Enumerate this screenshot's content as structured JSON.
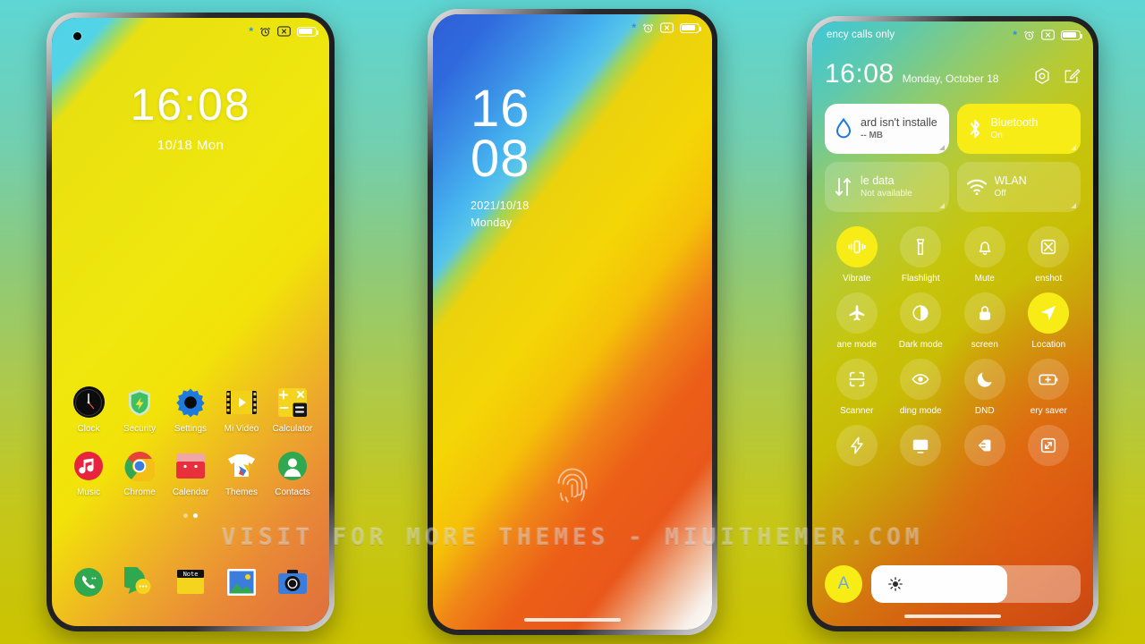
{
  "watermark": "VISIT FOR MORE THEMES - MIUITHEMER.COM",
  "colors": {
    "background_top": "#5ed6d4",
    "background_bottom": "#ccc300",
    "accent_yellow": "#f7ec16",
    "bluetooth_blue": "#1e90ff"
  },
  "phone1": {
    "statusbar": {
      "icons": [
        "bluetooth-icon",
        "alarm-icon",
        "silent-icon",
        "battery-icon"
      ]
    },
    "lockscreen": {
      "time": "16:08",
      "date": "10/18 Mon"
    },
    "apps_row1": [
      {
        "label": "Clock",
        "icon": "clock-icon"
      },
      {
        "label": "Security",
        "icon": "shield-icon"
      },
      {
        "label": "Settings",
        "icon": "gear-icon"
      },
      {
        "label": "Mi Video",
        "icon": "video-icon"
      },
      {
        "label": "Calculator",
        "icon": "calculator-icon"
      }
    ],
    "apps_row2": [
      {
        "label": "Music",
        "icon": "music-note-icon"
      },
      {
        "label": "Chrome",
        "icon": "chrome-icon"
      },
      {
        "label": "Calendar",
        "icon": "calendar-icon"
      },
      {
        "label": "Themes",
        "icon": "tshirt-icon"
      },
      {
        "label": "Contacts",
        "icon": "person-icon"
      }
    ],
    "dock": [
      {
        "label": "Phone",
        "icon": "phone-icon"
      },
      {
        "label": "Messages",
        "icon": "message-bubble-icon"
      },
      {
        "label": "Notes",
        "icon": "notes-icon",
        "badge": "Note"
      },
      {
        "label": "Gallery",
        "icon": "gallery-icon"
      },
      {
        "label": "Camera",
        "icon": "camera-icon"
      }
    ],
    "page_dots": {
      "count": 2,
      "active_index": 1
    }
  },
  "phone2": {
    "statusbar": {
      "icons": [
        "bluetooth-icon",
        "alarm-icon",
        "silent-icon",
        "battery-icon"
      ]
    },
    "lockscreen": {
      "hour": "16",
      "minute": "08",
      "date": "2021/10/18",
      "weekday": "Monday"
    },
    "fingerprint_label": "fingerprint-icon"
  },
  "phone3": {
    "statusbar": {
      "carrier": "ency calls only",
      "icons": [
        "bluetooth-icon",
        "alarm-icon",
        "silent-icon",
        "battery-icon"
      ]
    },
    "header": {
      "time": "16:08",
      "date": "Monday, October 18",
      "actions": [
        "settings-hex-icon",
        "edit-icon"
      ]
    },
    "big_tiles": [
      {
        "name": "ard isn't installe",
        "sub": "-- MB",
        "state": "white",
        "icon": "water-drop-icon"
      },
      {
        "name": "Bluetooth",
        "sub": "On",
        "state": "on",
        "icon": "bluetooth-icon"
      },
      {
        "name": "le data",
        "sub": "Not available",
        "state": "off",
        "icon": "data-arrows-icon"
      },
      {
        "name": "WLAN",
        "sub": "Off",
        "state": "off",
        "icon": "wifi-icon"
      }
    ],
    "toggles": [
      {
        "label": "Vibrate",
        "icon": "vibrate-icon",
        "active": true
      },
      {
        "label": "Flashlight",
        "icon": "flashlight-icon",
        "active": false
      },
      {
        "label": "Mute",
        "icon": "bell-icon",
        "active": false
      },
      {
        "label": "enshot",
        "icon": "screenshot-icon",
        "active": false
      },
      {
        "label": "ane mode",
        "icon": "airplane-icon",
        "active": false
      },
      {
        "label": "Dark mode",
        "icon": "dark-mode-icon",
        "active": false
      },
      {
        "label": "screen",
        "icon": "lock-icon",
        "active": false
      },
      {
        "label": "Location",
        "icon": "location-arrow-icon",
        "active": true
      },
      {
        "label": "Scanner",
        "icon": "scanner-icon",
        "active": false
      },
      {
        "label": "ding mode",
        "icon": "eye-icon",
        "active": false
      },
      {
        "label": "DND",
        "icon": "moon-icon",
        "active": false
      },
      {
        "label": "ery saver",
        "icon": "battery-plus-icon",
        "active": false
      },
      {
        "label": "",
        "icon": "lightning-icon",
        "active": false
      },
      {
        "label": "",
        "icon": "cast-screen-icon",
        "active": false
      },
      {
        "label": "",
        "icon": "contrast-icon",
        "active": false
      },
      {
        "label": "",
        "icon": "expand-icon",
        "active": false
      }
    ],
    "brightness": {
      "auto_label": "A",
      "level_percent": 65,
      "icon": "sun-icon"
    }
  }
}
